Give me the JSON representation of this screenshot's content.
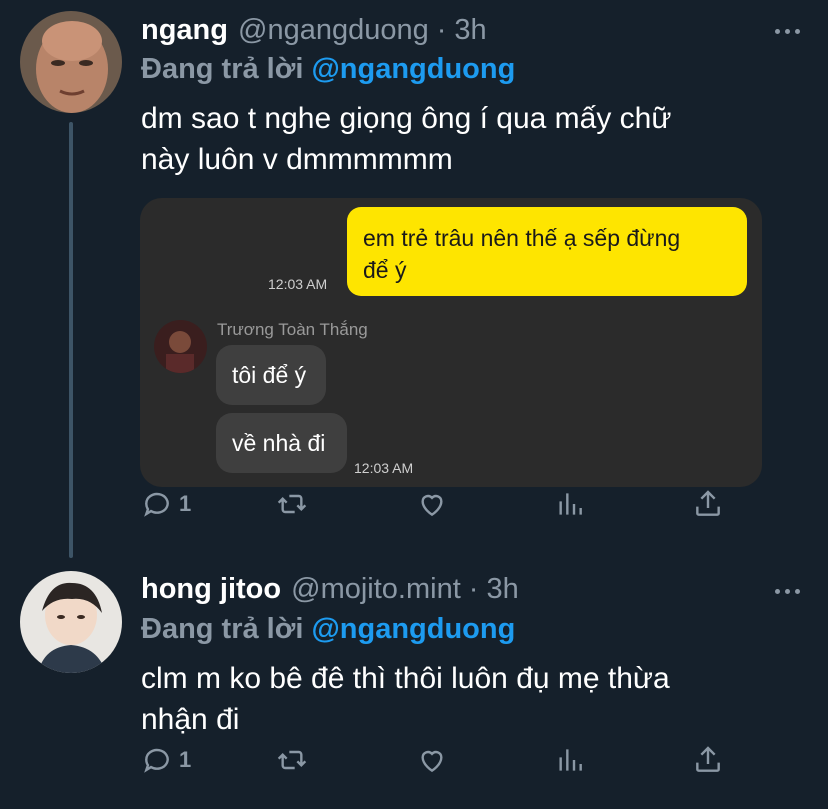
{
  "tweets": [
    {
      "display_name": "ngang",
      "handle": "@ngangduong",
      "separator": "·",
      "time": "3h",
      "reply_prefix": "Đang trả lời",
      "reply_to": "@ngangduong",
      "text_line1": "dm sao t nghe giọng ông í qua mấy chữ",
      "text_line2": "này luôn v dmmmmmm",
      "reply_count": "1",
      "media": {
        "outgoing_message_line1": "em trẻ trâu nên thế ạ sếp đừng",
        "outgoing_message_line2": "để ý",
        "outgoing_time": "12:03 AM",
        "sender_name": "Trương Toàn Thắng",
        "incoming_messages": [
          "tôi để ý",
          "về nhà đi"
        ],
        "incoming_time": "12:03 AM"
      }
    },
    {
      "display_name": "hong jitoo",
      "handle": "@mojito.mint",
      "separator": "·",
      "time": "3h",
      "reply_prefix": "Đang trả lời",
      "reply_to": "@ngangduong",
      "text_line1": "clm m ko bê đê thì thôi luôn đụ mẹ thừa",
      "text_line2": "nhận đi",
      "reply_count": "1"
    }
  ],
  "icons": [
    "comment-icon",
    "retweet-icon",
    "like-icon",
    "analytics-icon",
    "share-icon",
    "more-icon"
  ],
  "colors": {
    "background": "#15202b",
    "secondary_text": "#8b98a5",
    "link": "#1d9bf0",
    "chat_yellow": "#fee500",
    "chat_background": "#2b2b2b"
  }
}
